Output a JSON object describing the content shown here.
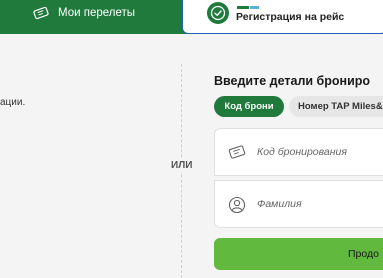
{
  "tabs": {
    "my_flights": {
      "label": "Мои перелеты",
      "icon": "ticket-icon"
    },
    "checkin": {
      "label": "Регистрация на рейс",
      "icon": "check-circle-icon"
    }
  },
  "left_panel": {
    "text_fragment": "ации."
  },
  "separator": {
    "label": "ИЛИ"
  },
  "booking_form": {
    "heading": "Введите детали брониро",
    "toggle": {
      "active": "Код брони",
      "inactive": "Номер TAP Miles&"
    },
    "booking_code": {
      "placeholder": "Код бронирования",
      "icon": "ticket-icon"
    },
    "last_name": {
      "placeholder": "Фамилия",
      "icon": "user-icon"
    },
    "submit": {
      "label": "Продо"
    }
  },
  "colors": {
    "brand_green": "#1f7a3c",
    "button_green": "#61b93e",
    "active_tab_border": "#1e5fb4"
  }
}
